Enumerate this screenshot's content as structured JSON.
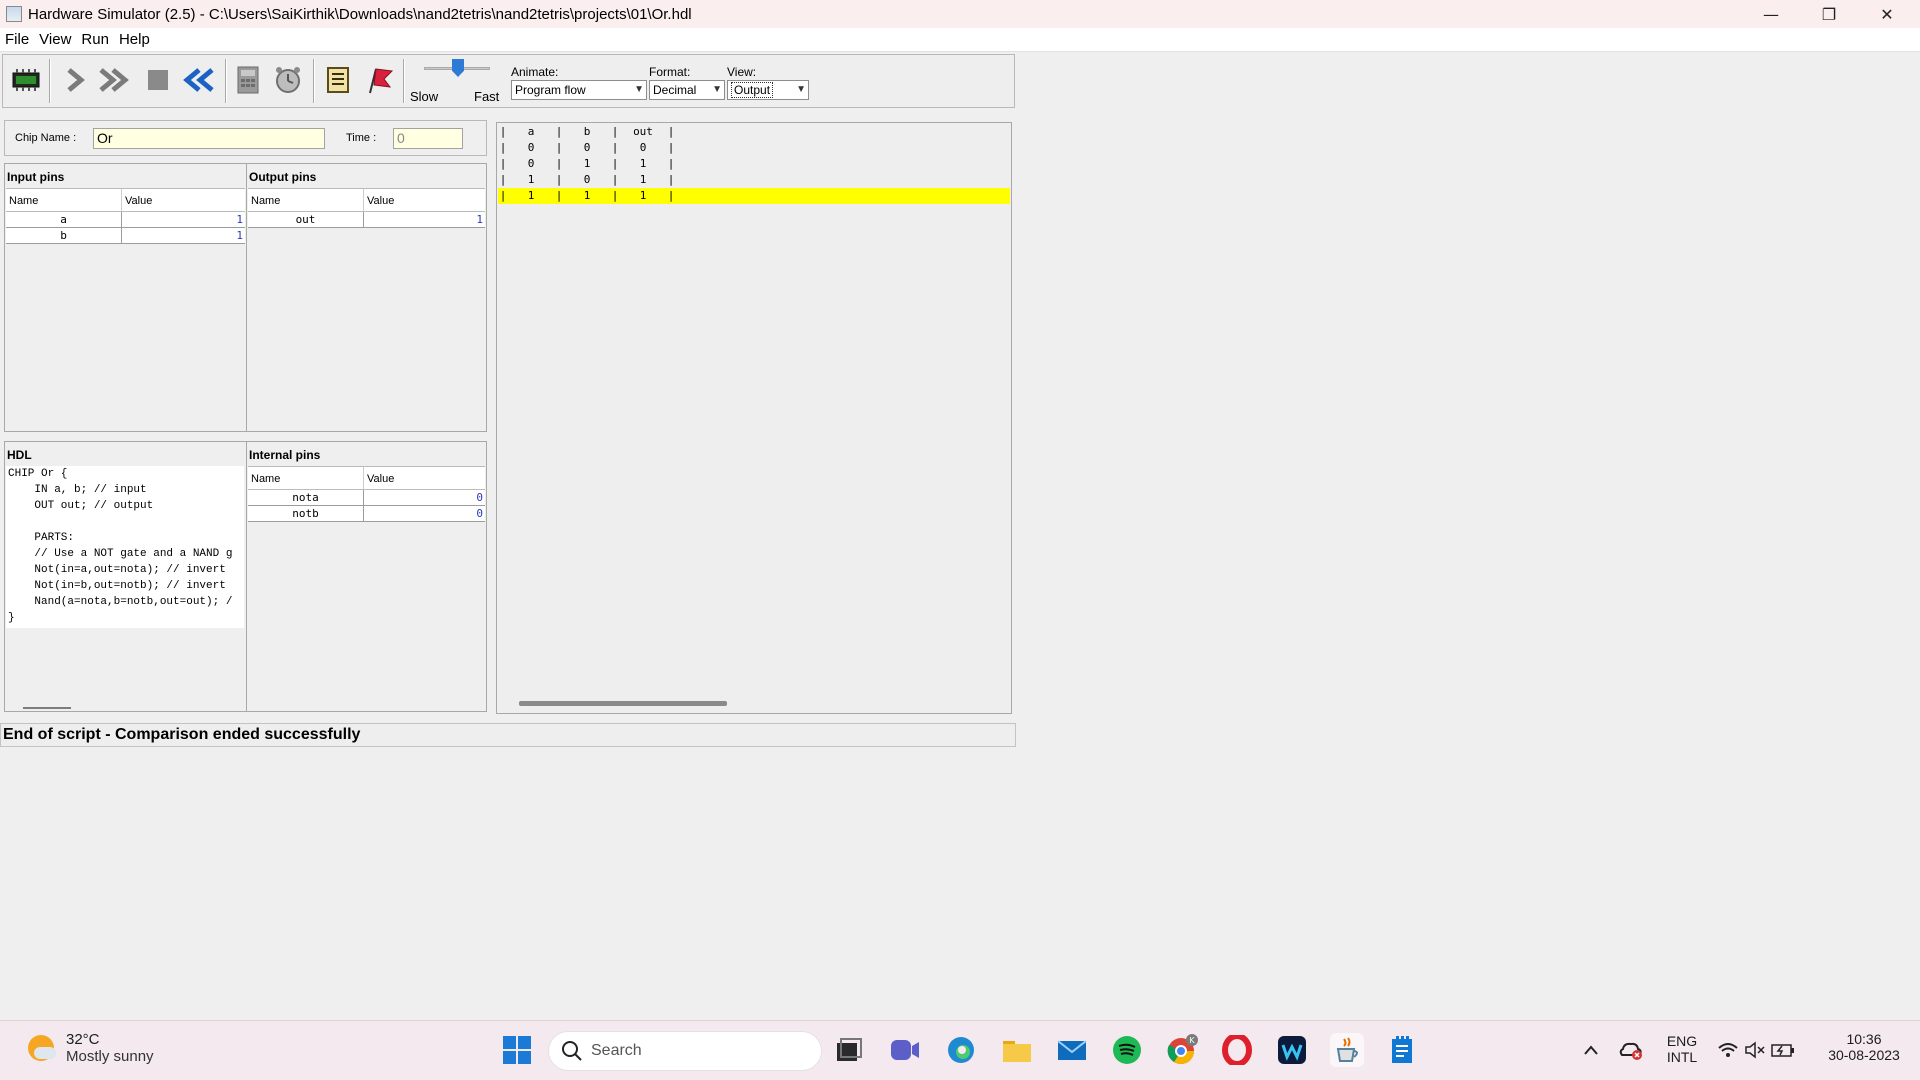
{
  "window": {
    "title": "Hardware Simulator (2.5) - C:\\Users\\SaiKirthik\\Downloads\\nand2tetris\\nand2tetris\\projects\\01\\Or.hdl",
    "minimize": "—",
    "maximize": "❐",
    "close": "✕"
  },
  "menu": [
    "File",
    "View",
    "Run",
    "Help"
  ],
  "toolbar": {
    "speed_slow": "Slow",
    "speed_fast": "Fast",
    "speed_level": 0.45,
    "animate_label": "Animate:",
    "animate_value": "Program flow",
    "format_label": "Format:",
    "format_value": "Decimal",
    "view_label": "View:",
    "view_value": "Output",
    "icons": [
      "load-chip-icon",
      "single-step-icon",
      "run-icon",
      "stop-icon",
      "reset-icon",
      "eval-icon",
      "clock-icon",
      "script-icon",
      "breakpoint-icon"
    ]
  },
  "chip": {
    "name_label": "Chip Name :",
    "name_value": "Or",
    "time_label": "Time :",
    "time_value": "0"
  },
  "input_pins": {
    "title": "Input pins",
    "col_name": "Name",
    "col_value": "Value",
    "rows": [
      {
        "name": "a",
        "value": "1"
      },
      {
        "name": "b",
        "value": "1"
      }
    ]
  },
  "output_pins": {
    "title": "Output pins",
    "col_name": "Name",
    "col_value": "Value",
    "rows": [
      {
        "name": "out",
        "value": "1"
      }
    ]
  },
  "hdl": {
    "title": "HDL",
    "lines": [
      "CHIP Or {",
      "    IN a, b; // input",
      "    OUT out; // output",
      "",
      "    PARTS:",
      "    // Use a NOT gate and a NAND g",
      "    Not(in=a,out=nota); // invert",
      "    Not(in=b,out=notb); // invert",
      "    Nand(a=nota,b=notb,out=out); /",
      "}"
    ]
  },
  "internal_pins": {
    "title": "Internal pins",
    "col_name": "Name",
    "col_value": "Value",
    "rows": [
      {
        "name": "nota",
        "value": "0"
      },
      {
        "name": "notb",
        "value": "0"
      }
    ]
  },
  "output_table": {
    "header": {
      "a": "a",
      "b": "b",
      "out": "out"
    },
    "rows": [
      {
        "a": "0",
        "b": "0",
        "out": "0"
      },
      {
        "a": "0",
        "b": "1",
        "out": "1"
      },
      {
        "a": "1",
        "b": "0",
        "out": "1"
      },
      {
        "a": "1",
        "b": "1",
        "out": "1"
      }
    ],
    "highlighted_row": 3,
    "separator": "|"
  },
  "status": "End of script - Comparison ended successfully",
  "taskbar": {
    "temperature": "32°C",
    "weather": "Mostly sunny",
    "search_label": "Search",
    "lang": "ENG",
    "layout": "INTL",
    "time": "10:36",
    "date": "30-08-2023",
    "badge": "K"
  }
}
